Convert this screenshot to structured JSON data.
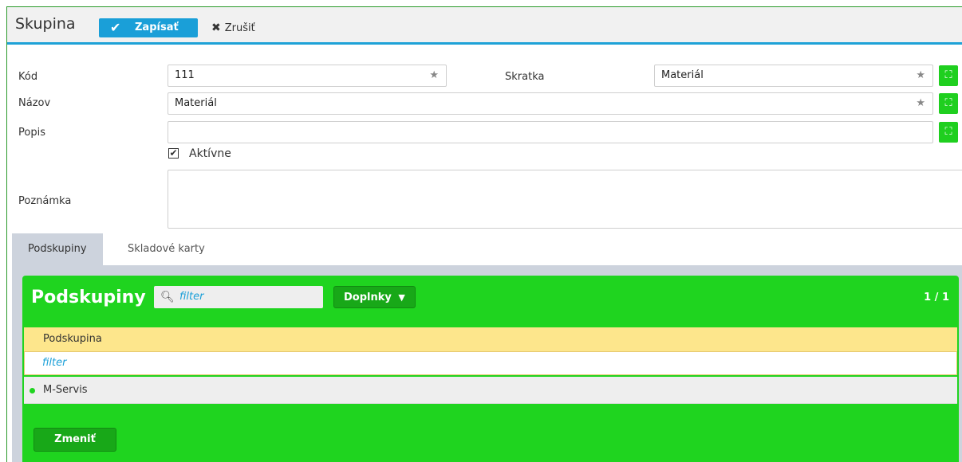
{
  "header": {
    "title": "Skupina",
    "save_label": "Zapísať",
    "cancel_label": "Zrušiť"
  },
  "form": {
    "code_label": "Kód",
    "code_value": "111",
    "abbr_label": "Skratka",
    "abbr_value": "Materiál",
    "name_label": "Názov",
    "name_value": "Materiál",
    "desc_label": "Popis",
    "desc_value": "",
    "active_label": "Aktívne",
    "active_checked": true,
    "note_label": "Poznámka",
    "note_value": ""
  },
  "tabs": [
    {
      "label": "Podskupiny",
      "active": true
    },
    {
      "label": "Skladové karty",
      "active": false
    }
  ],
  "panel": {
    "title": "Podskupiny",
    "filter_placeholder": "filter",
    "extras_label": "Doplnky",
    "count": "1 / 1",
    "column_header": "Podskupina",
    "column_filter_placeholder": "filter",
    "rows": [
      "M-Servis"
    ],
    "change_label": "Zmeniť"
  },
  "colors": {
    "accent_blue": "#1a9fd8",
    "panel_green": "#1fd41f",
    "header_yellow": "#fde68c"
  }
}
